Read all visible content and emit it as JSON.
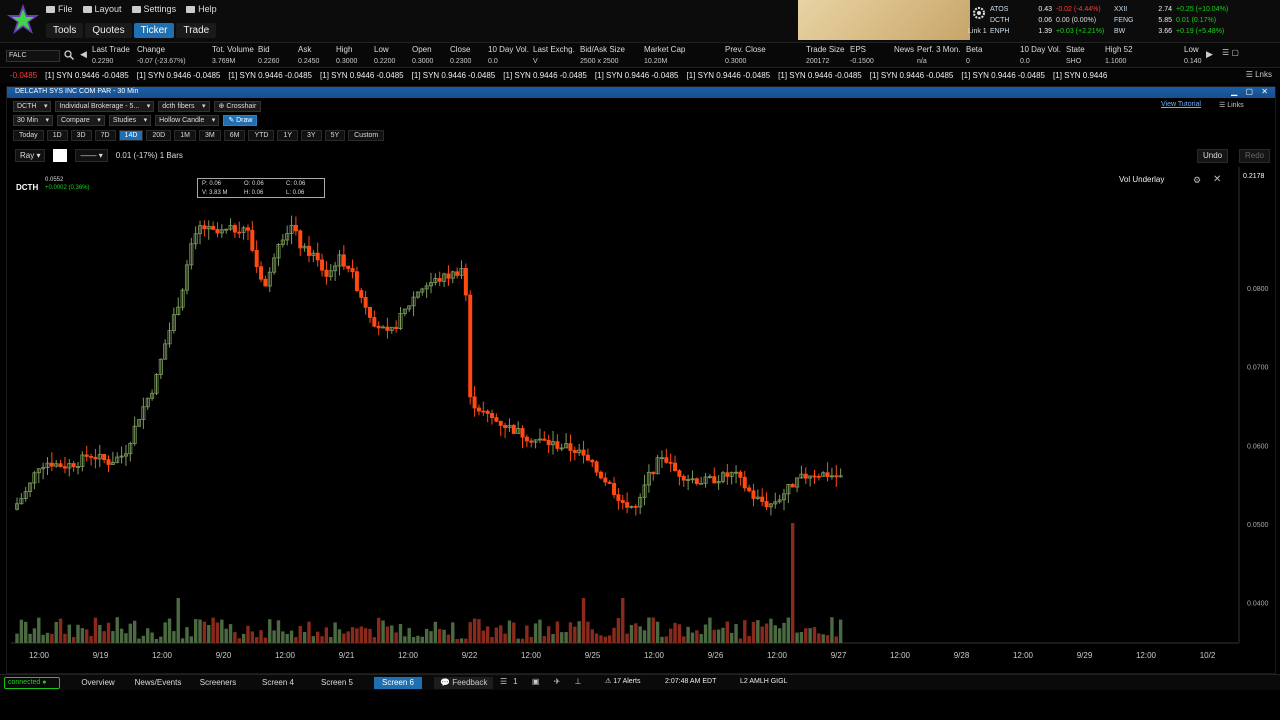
{
  "menu": {
    "items": [
      {
        "label": "File"
      },
      {
        "label": "Layout"
      },
      {
        "label": "Settings"
      },
      {
        "label": "Help"
      }
    ]
  },
  "modes": [
    {
      "label": "Tools",
      "active": false
    },
    {
      "label": "Quotes",
      "active": false
    },
    {
      "label": "Ticker",
      "active": true
    },
    {
      "label": "Trade",
      "active": false
    }
  ],
  "link": {
    "label": "Link 1"
  },
  "mini_tickers": [
    {
      "sym": "ATOS",
      "px": "0.43",
      "chg": "-0.02 (-4.44%)",
      "dir": "neg",
      "sym2": "XXII",
      "px2": "2.74",
      "chg2": "+0.25 (+10.04%)",
      "dir2": "pos"
    },
    {
      "sym": "DCTH",
      "px": "0.06",
      "chg": "0.00 (0.00%)",
      "dir": "neutral",
      "sym2": "FENG",
      "px2": "5.85",
      "chg2": "0.01 (0.17%)",
      "dir2": "pos"
    },
    {
      "sym": "ENPH",
      "px": "1.39",
      "chg": "+0.03 (+2.21%)",
      "dir": "pos",
      "sym2": "BW",
      "px2": "3.66",
      "chg2": "+0.19 (+5.48%)",
      "dir2": "pos"
    }
  ],
  "quote": {
    "symbol": "FALC",
    "columns": [
      {
        "head": "Last Trade",
        "value": "0.2290"
      },
      {
        "head": "Change",
        "value": "-0.07 (-23.67%)"
      },
      {
        "head": "Tot. Volume",
        "value": "3.769M"
      },
      {
        "head": "Bid",
        "value": "0.2260"
      },
      {
        "head": "Ask",
        "value": "0.2450"
      },
      {
        "head": "High",
        "value": "0.3000"
      },
      {
        "head": "Low",
        "value": "0.2200"
      },
      {
        "head": "Open",
        "value": "0.3000"
      },
      {
        "head": "Close",
        "value": "0.2300"
      },
      {
        "head": "10 Day Vol.",
        "value": "0.0"
      },
      {
        "head": "Last Exchg.",
        "value": "V"
      },
      {
        "head": "Bid/Ask Size",
        "value": "2500 x 2500"
      },
      {
        "head": "Market Cap",
        "value": "10.20M"
      },
      {
        "head": "Prev. Close",
        "value": "0.3000"
      },
      {
        "head": "Trade Size",
        "value": "200172"
      },
      {
        "head": "EPS",
        "value": "-0.1500"
      },
      {
        "head": "News",
        "value": ""
      },
      {
        "head": "Perf. 3 Mon.",
        "value": "n/a"
      },
      {
        "head": "Beta",
        "value": "0"
      },
      {
        "head": "10 Day Vol.",
        "value": "0.0"
      },
      {
        "head": "State",
        "value": "SHO"
      },
      {
        "head": "High 52",
        "value": "1.1000"
      },
      {
        "head": "Low",
        "value": "0.140"
      }
    ]
  },
  "tape": {
    "items": [
      "-0.0485",
      "[1] SYN 0.9446 -0.0485",
      "[1] SYN 0.9446 -0.0485",
      "[1] SYN 0.9446 -0.0485",
      "[1] SYN 0.9446 -0.0485",
      "[1] SYN 0.9446 -0.0485",
      "[1] SYN 0.9446 -0.0485",
      "[1] SYN 0.9446 -0.0485",
      "[1] SYN 0.9446 -0.0485",
      "[1] SYN 0.9446 -0.0485",
      "[1] SYN 0.9446 -0.0485",
      "[1] SYN 0.9446 -0.0485",
      "[1] SYN 0.9446"
    ]
  },
  "chartwin": {
    "title": "DELCATH SYS INC COM PAR - 30 Min",
    "account": "Individual Brokerage - 5...",
    "layout": "dcth fibers",
    "crosshair": "Crosshair",
    "studies": "Studies",
    "candle_type": "Hollow Candle",
    "draw": "Draw",
    "compare": "Compare",
    "view_tutorial": "View Tutorial",
    "links": "Links",
    "periods": [
      {
        "label": "Today",
        "active": false
      },
      {
        "label": "1D",
        "active": false
      },
      {
        "label": "3D",
        "active": false
      },
      {
        "label": "7D",
        "active": false
      },
      {
        "label": "14D",
        "active": true
      },
      {
        "label": "20D",
        "active": false
      },
      {
        "label": "1M",
        "active": false
      },
      {
        "label": "3M",
        "active": false
      },
      {
        "label": "6M",
        "active": false
      },
      {
        "label": "YTD",
        "active": false
      },
      {
        "label": "1Y",
        "active": false
      },
      {
        "label": "3Y",
        "active": false
      },
      {
        "label": "5Y",
        "active": false
      },
      {
        "label": "Custom",
        "active": false
      }
    ],
    "tool": "Ray",
    "line_style": "——",
    "bars_info": "0.01 (-17%) 1 Bars",
    "undo": "Undo",
    "redo": "Redo",
    "vol_underlay": "Vol Underlay"
  },
  "chart_data": {
    "type": "candlestick",
    "symbol": "DCTH",
    "symbol_px": "0.0552",
    "symbol_chg": "+0.0002 (0.36%)",
    "ohlc": {
      "open": "O: 0.06",
      "close": "C: 0.06",
      "p": "P: 0.06",
      "vol": "V: 3.83 M",
      "high": "H: 0.06",
      "low": "L: 0.06"
    },
    "last_price_label": "0.2178",
    "ylim": [
      0.035,
      0.095
    ],
    "y_ticks": [
      "0.0800",
      "0.0700",
      "0.0600",
      "0.0500",
      "0.0400"
    ],
    "x_ticks": [
      "12:00",
      "9/19",
      "12:00",
      "9/20",
      "12:00",
      "9/21",
      "12:00",
      "9/22",
      "12:00",
      "9/25",
      "12:00",
      "9/26",
      "12:00",
      "9/27",
      "12:00",
      "9/28",
      "12:00",
      "9/29",
      "12:00",
      "10/2"
    ],
    "colors": {
      "up": "#7c9b5e",
      "down": "#ff4a14",
      "vol_up": "#4c6a42",
      "vol_down": "#8a2a1c"
    },
    "series": [
      {
        "name": "price",
        "x_range": [
          "9/18 12:00",
          "9/27 09:30"
        ]
      }
    ]
  },
  "status": {
    "connected": "connected",
    "tabs": [
      {
        "label": "Overview",
        "active": false
      },
      {
        "label": "News/Events",
        "active": false
      },
      {
        "label": "Screeners",
        "active": false
      },
      {
        "label": "Screen 4",
        "active": false
      },
      {
        "label": "Screen 5",
        "active": false
      },
      {
        "label": "Screen 6",
        "active": true
      }
    ],
    "feedback": "Feedback",
    "alerts": "17 Alerts",
    "clock": "2:07:48 AM EDT",
    "level2": "L2 AMLH GIGL"
  }
}
